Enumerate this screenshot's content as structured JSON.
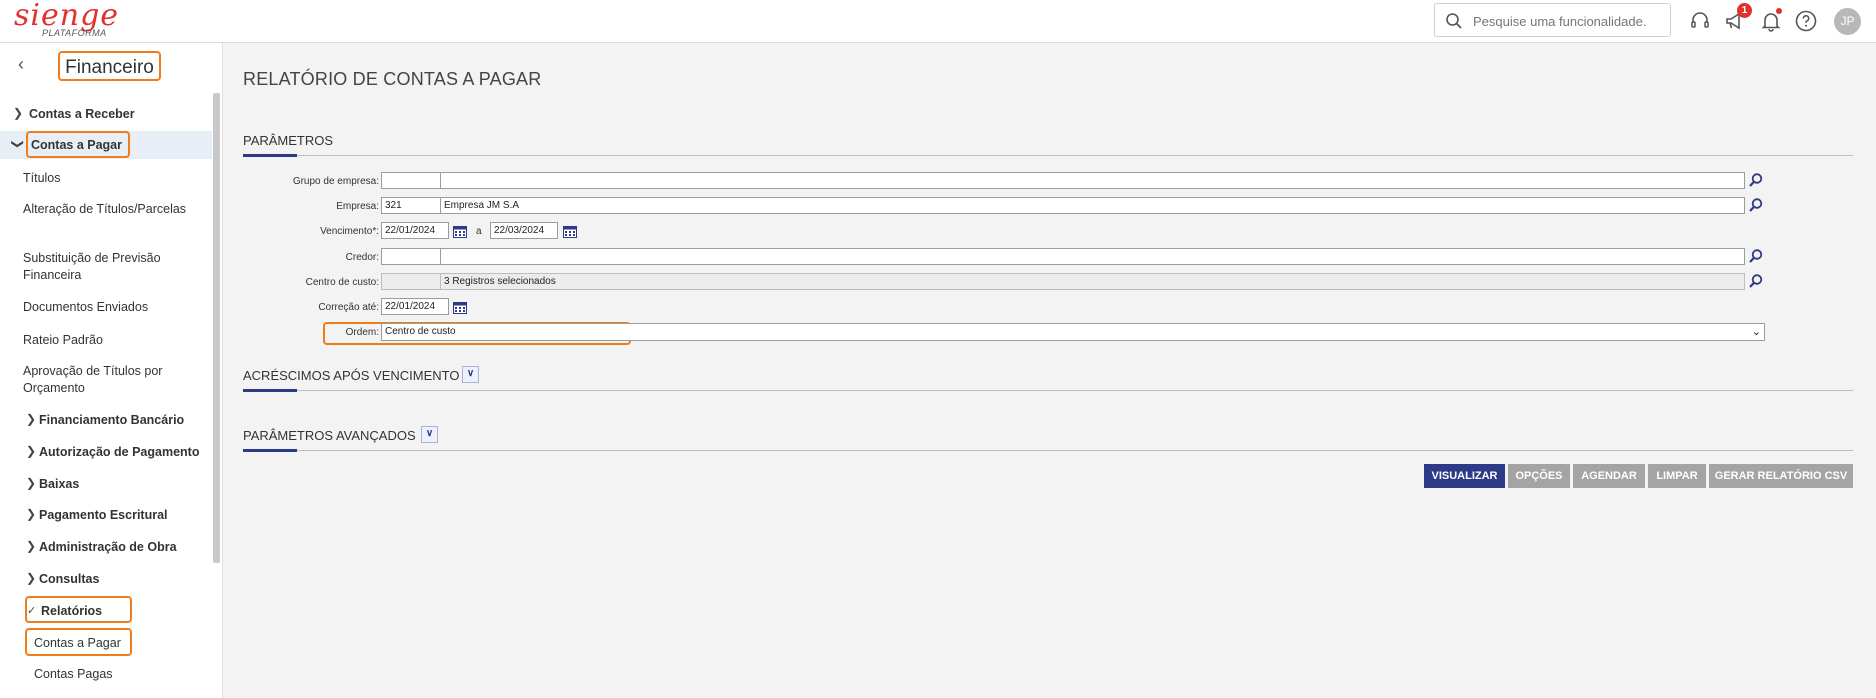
{
  "topbar": {
    "logo_text": "sienge",
    "logo_sub": "PLATAFORMA",
    "search_placeholder": "Pesquise uma funcionalidade.",
    "notification_count": "1",
    "avatar_initials": "JP"
  },
  "sidebar": {
    "title": "Financeiro",
    "items": [
      {
        "label": "Contas a Receber"
      },
      {
        "label": "Contas a Pagar"
      },
      {
        "label": "Títulos"
      },
      {
        "label": "Alteração de Títulos/Parcelas"
      },
      {
        "label": "Substituição de Previsão Financeira"
      },
      {
        "label": "Documentos Enviados"
      },
      {
        "label": "Rateio Padrão"
      },
      {
        "label": "Aprovação de Títulos por Orçamento"
      },
      {
        "label": "Financiamento Bancário"
      },
      {
        "label": "Autorização de Pagamento"
      },
      {
        "label": "Baixas"
      },
      {
        "label": "Pagamento Escritural"
      },
      {
        "label": "Administração de Obra"
      },
      {
        "label": "Consultas"
      },
      {
        "label": "Relatórios"
      },
      {
        "label": "Contas a Pagar"
      },
      {
        "label": "Contas Pagas"
      }
    ]
  },
  "main": {
    "page_title": "RELATÓRIO DE CONTAS A PAGAR",
    "sections": {
      "parametros": "PARÂMETROS",
      "acrescimos": "ACRÉSCIMOS APÓS VENCIMENTO",
      "avancados": "PARÂMETROS AVANÇADOS"
    },
    "fields": {
      "grupo_empresa": {
        "label": "Grupo de empresa:",
        "code": "",
        "name": ""
      },
      "empresa": {
        "label": "Empresa:",
        "code": "321",
        "name": "Empresa JM S.A"
      },
      "vencimento": {
        "label": "Vencimento*:",
        "from": "22/01/2024",
        "between": "a",
        "to": "22/03/2024"
      },
      "credor": {
        "label": "Credor:",
        "code": "",
        "name": ""
      },
      "centro_custo": {
        "label": "Centro de custo:",
        "code": "",
        "name": "3 Registros selecionados"
      },
      "correcao": {
        "label": "Correção até:",
        "value": "22/01/2024"
      },
      "ordem": {
        "label": "Ordem:",
        "selected": "Centro de custo"
      }
    },
    "buttons": {
      "visualizar": "VISUALIZAR",
      "opcoes": "OPÇÕES",
      "agendar": "AGENDAR",
      "limpar": "LIMPAR",
      "csv": "GERAR RELATÓRIO CSV"
    }
  },
  "colors": {
    "brand": "#e0312e",
    "primary": "#2c3a87",
    "highlight": "#f07c1c",
    "button_disabled": "#a4a4a4"
  }
}
